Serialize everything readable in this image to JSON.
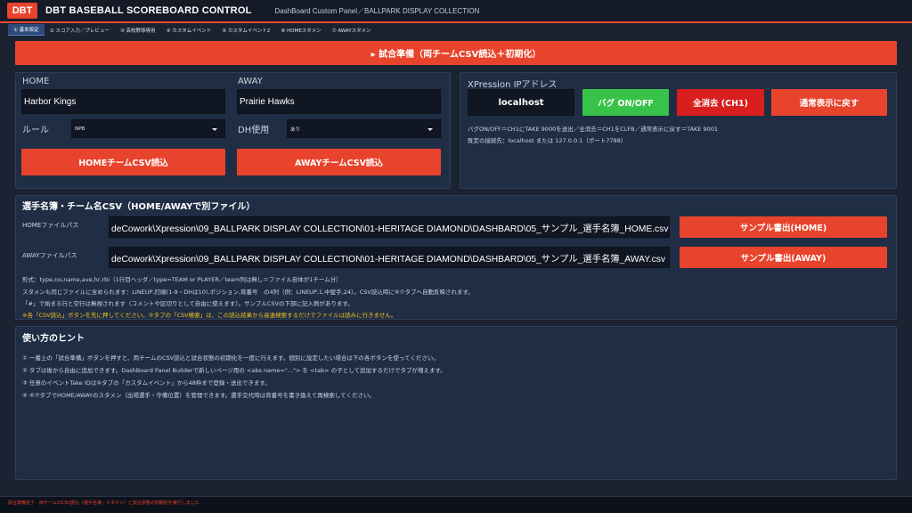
{
  "header": {
    "logo": "DBT",
    "title": "DBT BASEBALL SCOREBOARD CONTROL",
    "panel_path": "DashBoard Custom Panel／BALLPARK DISPLAY COLLECTION"
  },
  "tabs": [
    {
      "label": "① 基本設定",
      "active": true
    },
    {
      "label": "② スコア入力／プレビュー"
    },
    {
      "label": "③ 高校野球専用"
    },
    {
      "label": "④ カスタムイベント"
    },
    {
      "label": "⑤ カスタムイベント2"
    },
    {
      "label": "⑥ HOMEスタメン"
    },
    {
      "label": "⑦ AWAYスタメン"
    }
  ],
  "prepare_button": "▸ 試合準備（両チームCSV読込＋初期化）",
  "teams": {
    "home_label": "HOME",
    "away_label": "AWAY",
    "home_name": "Harbor Kings",
    "away_name": "Prairie Hawks",
    "rule_label": "ルール",
    "rule_value": "NPB",
    "dh_label": "DH使用",
    "dh_value": "あり",
    "home_csv_button": "HOMEチームCSV読込",
    "away_csv_button": "AWAYチームCSV読込"
  },
  "xpression": {
    "title": "XPression IPアドレス",
    "ip_value": "localhost",
    "bug_button": "バグ ON/OFF",
    "clear_button": "全消去 (CH1)",
    "normal_button": "通常表示に戻す",
    "note1": "バグON/OFF＝CH1にTAKE 9000を送出／全消去＝CH1をCLFB／通常表示に戻す＝TAKE 9001",
    "note2": "既定の接続先：localhost または 127.0.0.1（ポート7788）"
  },
  "roster": {
    "title": "選手名簿・チーム名CSV（HOME/AWAYで別ファイル）",
    "home_path_label": "HOMEファイルパス",
    "away_path_label": "AWAYファイルパス",
    "home_path": "deCowork\\Xpression\\09_BALLPARK DISPLAY COLLECTION\\01-HERITAGE DIAMOND\\DASHBARD\\05_サンプル_選手名簿_HOME.csv",
    "away_path": "deCowork\\Xpression\\09_BALLPARK DISPLAY COLLECTION\\01-HERITAGE DIAMOND\\DASHBARD\\05_サンプル_選手名簿_AWAY.csv",
    "home_export_button": "サンプル書出(HOME)",
    "away_export_button": "サンプル書出(AWAY)",
    "note1": "形式：type,no,name,ave,hr,rbi（1行目ヘッダ／type=TEAM or PLAYER／team列は無し＝ファイル自体が1チーム分）",
    "note2": "スタメンも同じファイルに含められます：LINEUP,打順(1-9・DHは10),ポジション,背番号　の4列（例：LINEUP,1,中堅手,24）。CSV読込時に⑥⑦タブへ自動反映されます。",
    "note3": "「#」で始まる行と空行は無視されます（コメントや区切りとして自由に使えます）。サンプルCSVの下部に記入例があります。",
    "note4": "※各「CSV読込」ボタンを先に押してください。②タブの「CSV検索」は、この読込結果から高速検索するだけでファイルは読みに行きません。"
  },
  "howto": {
    "title": "使い方のヒント",
    "lines": [
      "① 一番上の「試合準備」ボタンを押すと、両チームのCSV読込と試合状態の初期化を一度に行えます。個別に設定したい場合は下の各ボタンを使ってください。",
      "② タブは後から自由に追加できます。DashBoard Panel Builderで新しいページ用の <abs name=\"...\"> を <tab> の子として追加するだけでタブが増えます。",
      "③ 任意のイベントTake IDは④タブの「カスタムイベント」から48枠まで登録・送出できます。",
      "④ ⑥⑦タブでHOME/AWAYのスタメン（出場選手・守備位置）を管理できます。選手交代時は背番号を書き換えて再検索してください。"
    ]
  },
  "status": {
    "text": "試合準備完了　両チームのCSV読込（選手名簿・スタメン）と試合状態の初期化を実行しました"
  },
  "colors": {
    "accent": "#e8432c",
    "green": "#39c24a",
    "panel": "#1f2d45",
    "background": "#1b2333",
    "note_highlight": "#f2c21b"
  }
}
